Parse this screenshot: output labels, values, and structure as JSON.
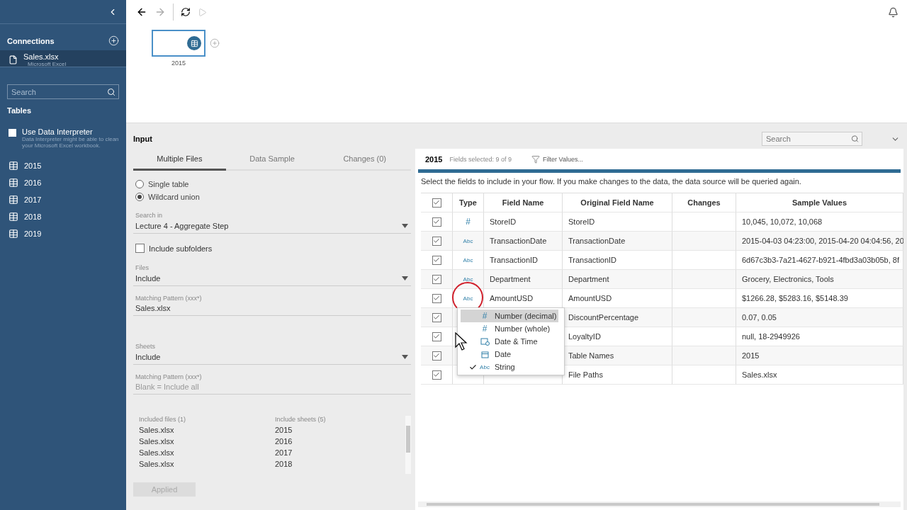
{
  "sidebar": {
    "connections_title": "Connections",
    "connection": {
      "name": "Sales.xlsx",
      "type": "Microsoft Excel",
      "selected": true
    },
    "search": {
      "placeholder": "Search"
    },
    "tables_title": "Tables",
    "interpreter": {
      "label": "Use Data Interpreter",
      "hint": "Data Interpreter might be able to clean your Microsoft Excel workbook.",
      "checked": false
    },
    "tables": [
      "2015",
      "2016",
      "2017",
      "2018",
      "2019"
    ]
  },
  "canvas": {
    "node_label": "2015"
  },
  "input": {
    "title": "Input",
    "search": {
      "placeholder": "Search"
    },
    "tabs": [
      {
        "label": "Multiple Files",
        "selected": true
      },
      {
        "label": "Data Sample",
        "selected": false
      },
      {
        "label": "Changes (0)",
        "selected": false
      }
    ],
    "modes": [
      {
        "label": "Single table",
        "selected": false
      },
      {
        "label": "Wildcard union",
        "selected": true
      }
    ],
    "search_in": {
      "label": "Search in",
      "value": "Lecture 4 - Aggregate Step"
    },
    "include_subfolders": {
      "label": "Include subfolders",
      "checked": false
    },
    "files": {
      "label": "Files",
      "value": "Include"
    },
    "files_pattern": {
      "label": "Matching Pattern (xxx*)",
      "value": "Sales.xlsx"
    },
    "sheets": {
      "label": "Sheets",
      "value": "Include"
    },
    "sheets_pattern": {
      "label": "Matching Pattern (xxx*)",
      "placeholder": "Blank = Include all"
    },
    "included": {
      "files_header": "Included files (1)",
      "sheets_header": "Include sheets (5)",
      "rows": [
        {
          "file": "Sales.xlsx",
          "sheet": "2015"
        },
        {
          "file": "Sales.xlsx",
          "sheet": "2016"
        },
        {
          "file": "Sales.xlsx",
          "sheet": "2017"
        },
        {
          "file": "Sales.xlsx",
          "sheet": "2018"
        }
      ]
    },
    "apply_button": {
      "label": "Applied",
      "disabled": true
    }
  },
  "fields": {
    "table_name": "2015",
    "selected_count": "Fields selected: 9 of 9",
    "filter": "Filter Values...",
    "instructions": "Select the fields to include in your flow. If you make changes to the data, the data source will be queried again.",
    "all_checked": true,
    "columns": [
      "Type",
      "Field Name",
      "Original Field Name",
      "Changes",
      "Sample Values"
    ],
    "rows": [
      {
        "checked": true,
        "type": "#",
        "field_name": "StoreID",
        "original": "StoreID",
        "sample": "10,045, 10,072, 10,068"
      },
      {
        "checked": true,
        "type": "Abc",
        "field_name": "TransactionDate",
        "original": "TransactionDate",
        "sample": "2015-04-03 04:23:00, 2015-04-20 04:04:56, 20"
      },
      {
        "checked": true,
        "type": "Abc",
        "field_name": "TransactionID",
        "original": "TransactionID",
        "sample": "6d67c3b3-7a21-4627-b921-4fbd3a03b05b, 8f"
      },
      {
        "checked": true,
        "type": "Abc",
        "field_name": "Department",
        "original": "Department",
        "sample": "Grocery, Electronics, Tools"
      },
      {
        "checked": true,
        "type": "Abc",
        "field_name": "AmountUSD",
        "original": "AmountUSD",
        "sample": "$1266.28, $5283.16, $5148.39",
        "highlighted": true
      },
      {
        "checked": true,
        "original": "DiscountPercentage",
        "sample": "0.07, 0.05"
      },
      {
        "checked": true,
        "original": "LoyaltyID",
        "sample": "null, 18-2949926"
      },
      {
        "checked": true,
        "original": "Table Names",
        "sample": "2015"
      },
      {
        "checked": true,
        "original": "File Paths",
        "sample": "Sales.xlsx"
      }
    ],
    "type_menu_open": true,
    "type_menu": [
      {
        "kind": "text",
        "icon": "#",
        "label": "Number (decimal)",
        "selected": true,
        "checked": false
      },
      {
        "kind": "text",
        "icon": "#",
        "label": "Number (whole)",
        "selected": false,
        "checked": false
      },
      {
        "kind": "datetime",
        "label": "Date & Time",
        "selected": false,
        "checked": false
      },
      {
        "kind": "date",
        "label": "Date",
        "selected": false,
        "checked": false
      },
      {
        "kind": "text",
        "icon": "Abc",
        "label": "String",
        "selected": false,
        "checked": true
      }
    ]
  }
}
